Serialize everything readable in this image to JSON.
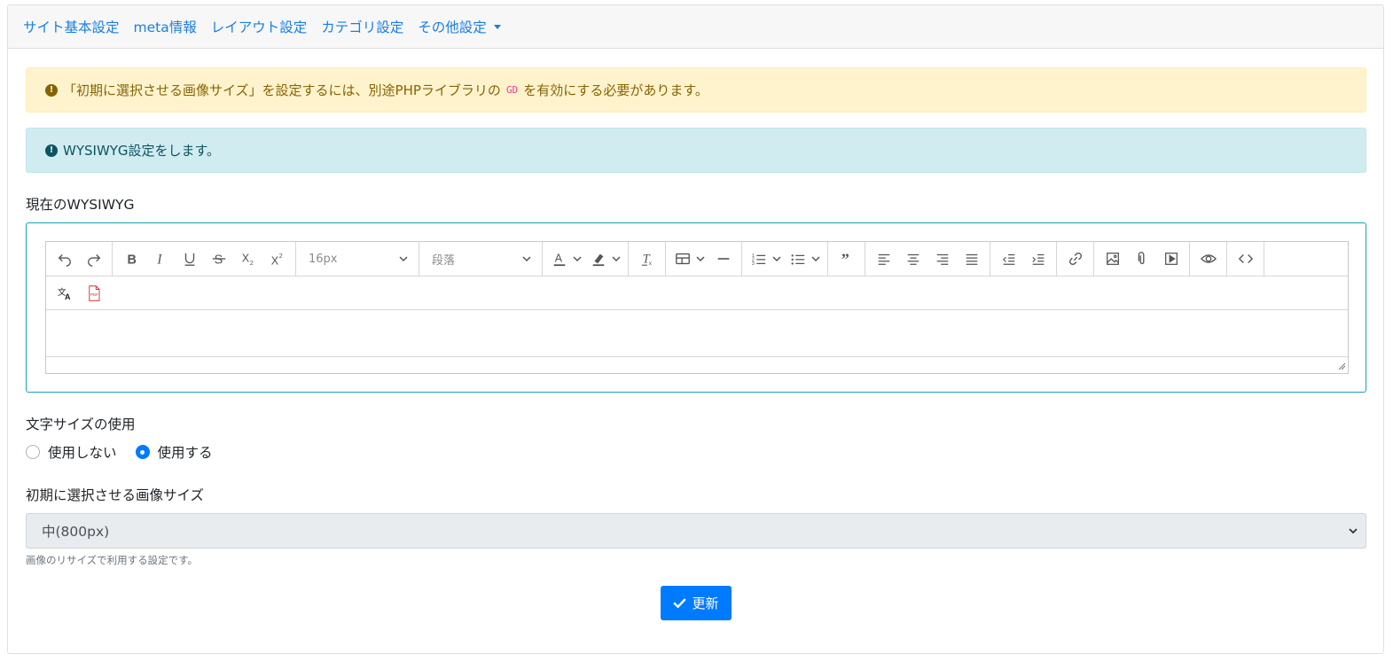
{
  "nav": {
    "items": [
      "サイト基本設定",
      "meta情報",
      "レイアウト設定",
      "カテゴリ設定",
      "その他設定"
    ]
  },
  "alerts": {
    "warning_prefix": "「初期に選択させる画像サイズ」を設定するには、別途PHPライブラリの",
    "warning_code": "GD",
    "warning_suffix": "を有効にする必要があります。",
    "info": "WYSIWYG設定をします。"
  },
  "wysiwyg": {
    "label": "現在のWYSIWYG",
    "font_size": "16px",
    "block_format": "段落",
    "pdf_label": "PDF"
  },
  "font_size_use": {
    "label": "文字サイズの使用",
    "options": [
      "使用しない",
      "使用する"
    ],
    "selected": "使用する"
  },
  "image_size": {
    "label": "初期に選択させる画像サイズ",
    "value": "中(800px)",
    "help": "画像のリサイズで利用する設定です。"
  },
  "submit_label": "更新",
  "colors": {
    "link": "#1a7fe0",
    "primary": "#007bff",
    "warning_bg": "#fff3cd",
    "info_bg": "#d1ecf1",
    "editor_focus_border": "#17a2b8"
  }
}
